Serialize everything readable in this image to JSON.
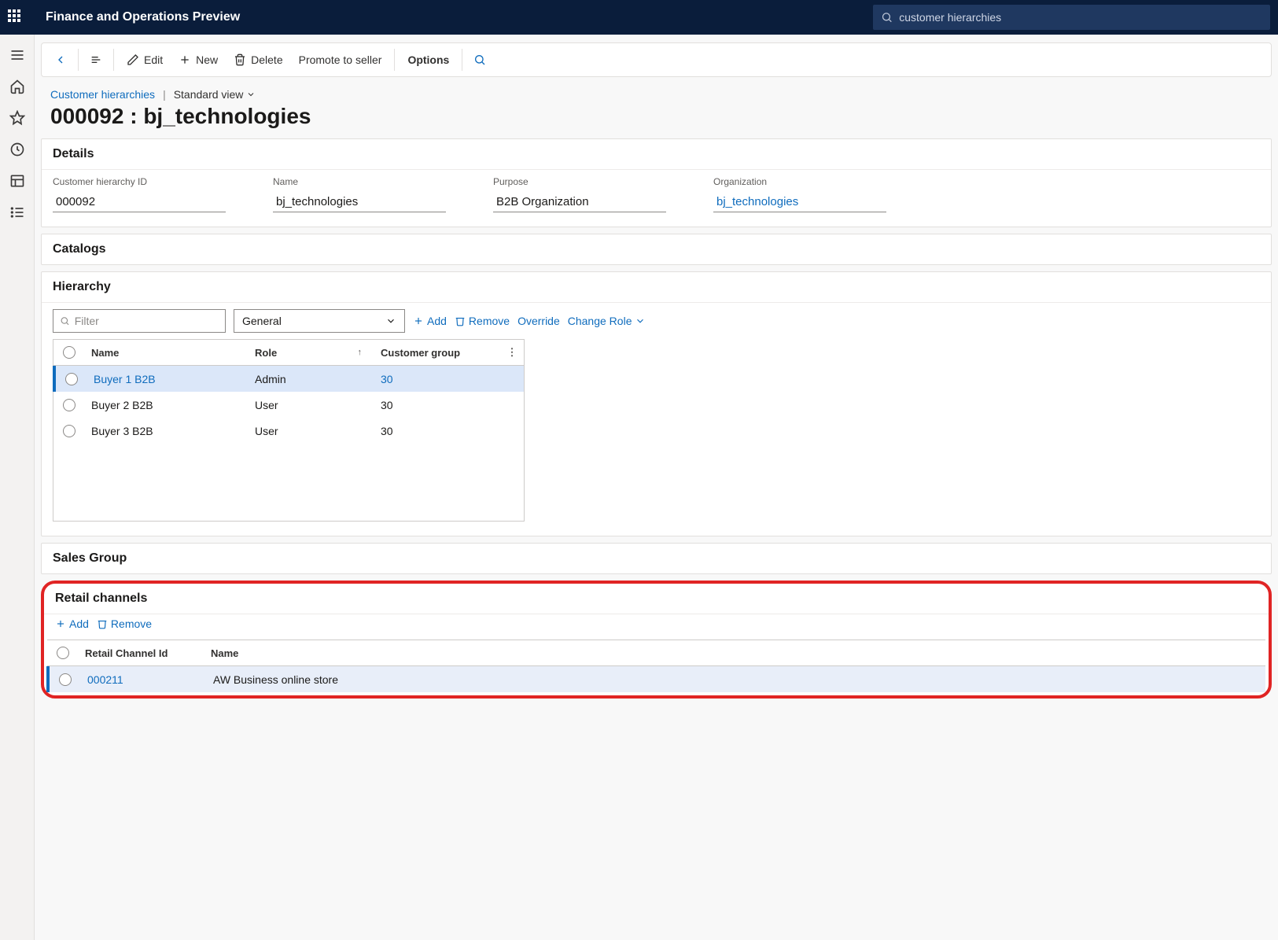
{
  "app_title": "Finance and Operations Preview",
  "search_value": "customer hierarchies",
  "cmdbar": {
    "edit": "Edit",
    "new": "New",
    "delete": "Delete",
    "promote": "Promote to seller",
    "options": "Options"
  },
  "breadcrumb": {
    "link": "Customer hierarchies",
    "view": "Standard view"
  },
  "page_title": "000092 : bj_technologies",
  "details": {
    "title": "Details",
    "fields": {
      "hierarchy_id": {
        "label": "Customer hierarchy ID",
        "value": "000092"
      },
      "name": {
        "label": "Name",
        "value": "bj_technologies"
      },
      "purpose": {
        "label": "Purpose",
        "value": "B2B Organization"
      },
      "organization": {
        "label": "Organization",
        "value": "bj_technologies"
      }
    }
  },
  "catalogs_title": "Catalogs",
  "hierarchy": {
    "title": "Hierarchy",
    "filter_placeholder": "Filter",
    "select_value": "General",
    "actions": {
      "add": "Add",
      "remove": "Remove",
      "override": "Override",
      "change_role": "Change Role"
    },
    "columns": {
      "name": "Name",
      "role": "Role",
      "group": "Customer group"
    },
    "rows": [
      {
        "name": "Buyer 1 B2B",
        "role": "Admin",
        "group": "30",
        "selected": true
      },
      {
        "name": "Buyer 2 B2B",
        "role": "User",
        "group": "30",
        "selected": false
      },
      {
        "name": "Buyer 3 B2B",
        "role": "User",
        "group": "30",
        "selected": false
      }
    ]
  },
  "sales_group_title": "Sales Group",
  "retail": {
    "title": "Retail channels",
    "actions": {
      "add": "Add",
      "remove": "Remove"
    },
    "columns": {
      "id": "Retail Channel Id",
      "name": "Name"
    },
    "rows": [
      {
        "id": "000211",
        "name": "AW Business online store"
      }
    ]
  }
}
